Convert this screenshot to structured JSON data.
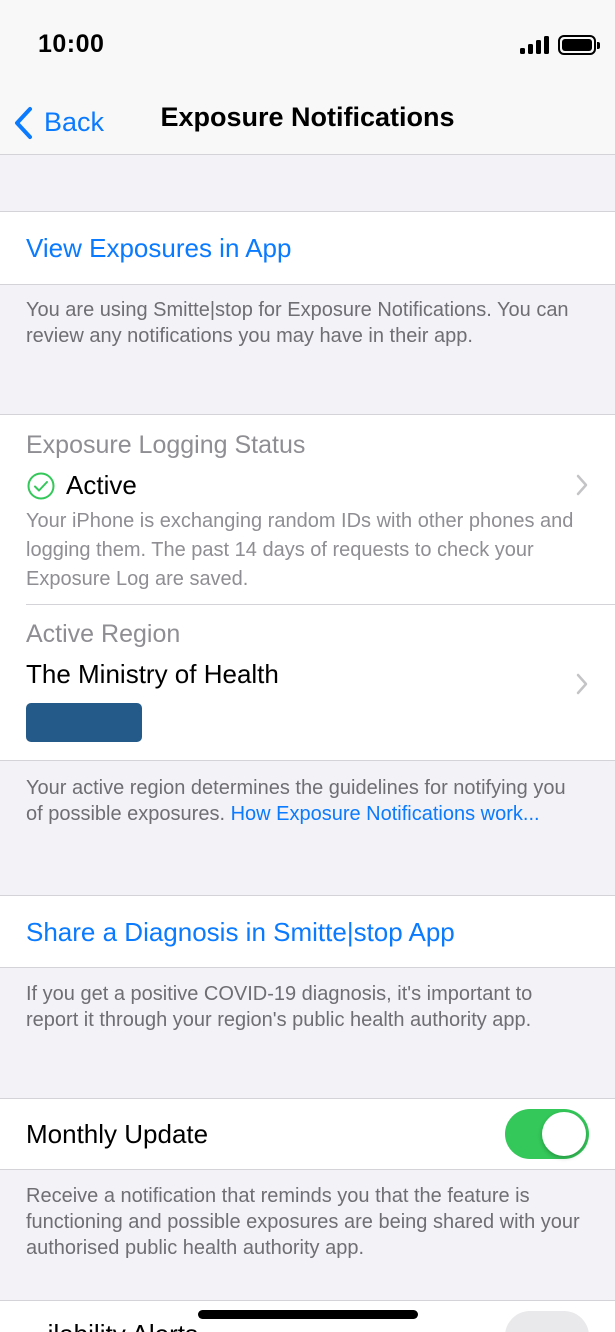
{
  "status_bar": {
    "time": "10:00"
  },
  "nav": {
    "back_label": "Back",
    "title": "Exposure Notifications"
  },
  "view_exposures": {
    "link_label": "View Exposures in App",
    "footer": "You are using Smitte|stop for Exposure Notifications. You can review any notifications you may have in their app."
  },
  "logging": {
    "label": "Exposure Logging Status",
    "status": "Active",
    "description": "Your iPhone is exchanging random IDs with other phones and logging them. The past 14 days of requests to check your Exposure Log are saved."
  },
  "region": {
    "label": "Active Region",
    "value": "The Ministry of Health",
    "footer_text": "Your active region determines the guidelines for notifying you of possible exposures. ",
    "footer_link": "How Exposure Notifications work..."
  },
  "share": {
    "link_label": "Share a Diagnosis in Smitte|stop App",
    "footer": "If you get a positive COVID-19 diagnosis, it's important to report it through your region's public health authority app."
  },
  "monthly": {
    "label": "Monthly Update",
    "enabled": true,
    "footer": "Receive a notification that reminds you that the feature is functioning and possible exposures are being shared with your authorised public health authority app."
  },
  "availability": {
    "label_partial": "...ilability Alerts"
  },
  "colors": {
    "accent": "#0a7aff",
    "toggle_on": "#34c759",
    "active_check": "#34c759",
    "region_badge": "#235a8a"
  }
}
